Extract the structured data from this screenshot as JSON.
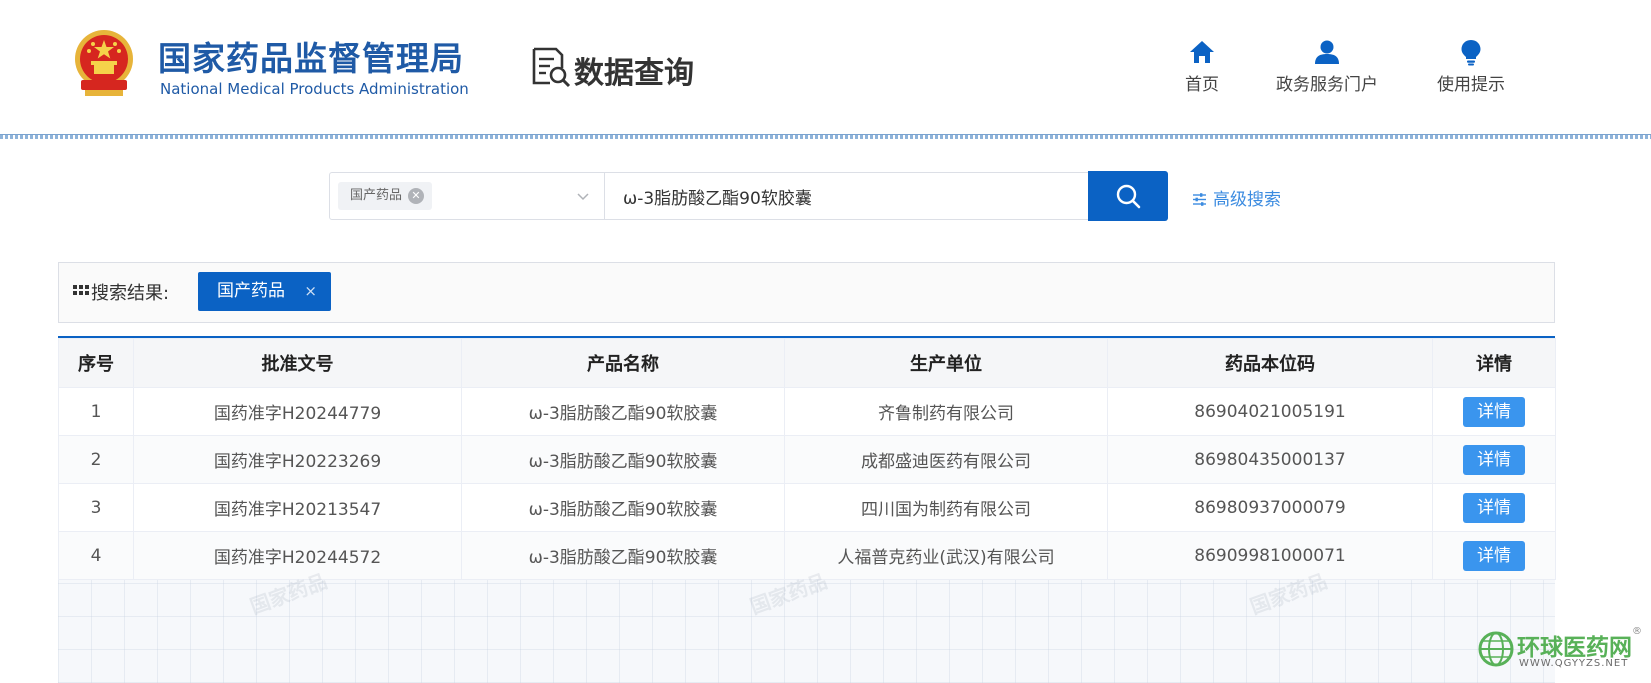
{
  "header": {
    "org_name_cn": "国家药品监督管理局",
    "org_name_en": "National Medical Products Administration",
    "section_title": "数据查询",
    "nav": [
      {
        "label": "首页",
        "icon": "home-icon"
      },
      {
        "label": "政务服务门户",
        "icon": "user-icon"
      },
      {
        "label": "使用提示",
        "icon": "lightbulb-icon"
      }
    ]
  },
  "search": {
    "category_tag": "国产药品",
    "query": "ω-3脂肪酸乙酯90软胶囊",
    "advanced_label": "高级搜索"
  },
  "results": {
    "label": "搜索结果:",
    "filter_chip": "国产药品",
    "filter_chip_close": "×"
  },
  "table": {
    "headers": [
      "序号",
      "批准文号",
      "产品名称",
      "生产单位",
      "药品本位码",
      "详情"
    ],
    "rows": [
      {
        "index": "1",
        "approval_no": "国药准字H20244779",
        "product": "ω-3脂肪酸乙酯90软胶囊",
        "manufacturer": "齐鲁制药有限公司",
        "code": "86904021005191",
        "detail": "详情"
      },
      {
        "index": "2",
        "approval_no": "国药准字H20223269",
        "product": "ω-3脂肪酸乙酯90软胶囊",
        "manufacturer": "成都盛迪医药有限公司",
        "code": "86980435000137",
        "detail": "详情"
      },
      {
        "index": "3",
        "approval_no": "国药准字H20213547",
        "product": "ω-3脂肪酸乙酯90软胶囊",
        "manufacturer": "四川国为制药有限公司",
        "code": "86980937000079",
        "detail": "详情"
      },
      {
        "index": "4",
        "approval_no": "国药准字H20244572",
        "product": "ω-3脂肪酸乙酯90软胶囊",
        "manufacturer": "人福普克药业(武汉)有限公司",
        "code": "86909981000071",
        "detail": "详情"
      }
    ]
  },
  "corner_logo": {
    "name_cn": "环球医药网",
    "url": "WWW.QGYYZS.NET",
    "reg": "®"
  },
  "colors": {
    "brand_blue": "#0b62c4",
    "org_blue": "#1f5aa6",
    "detail_button": "#3a95ee",
    "logo_green": "#58b158"
  }
}
